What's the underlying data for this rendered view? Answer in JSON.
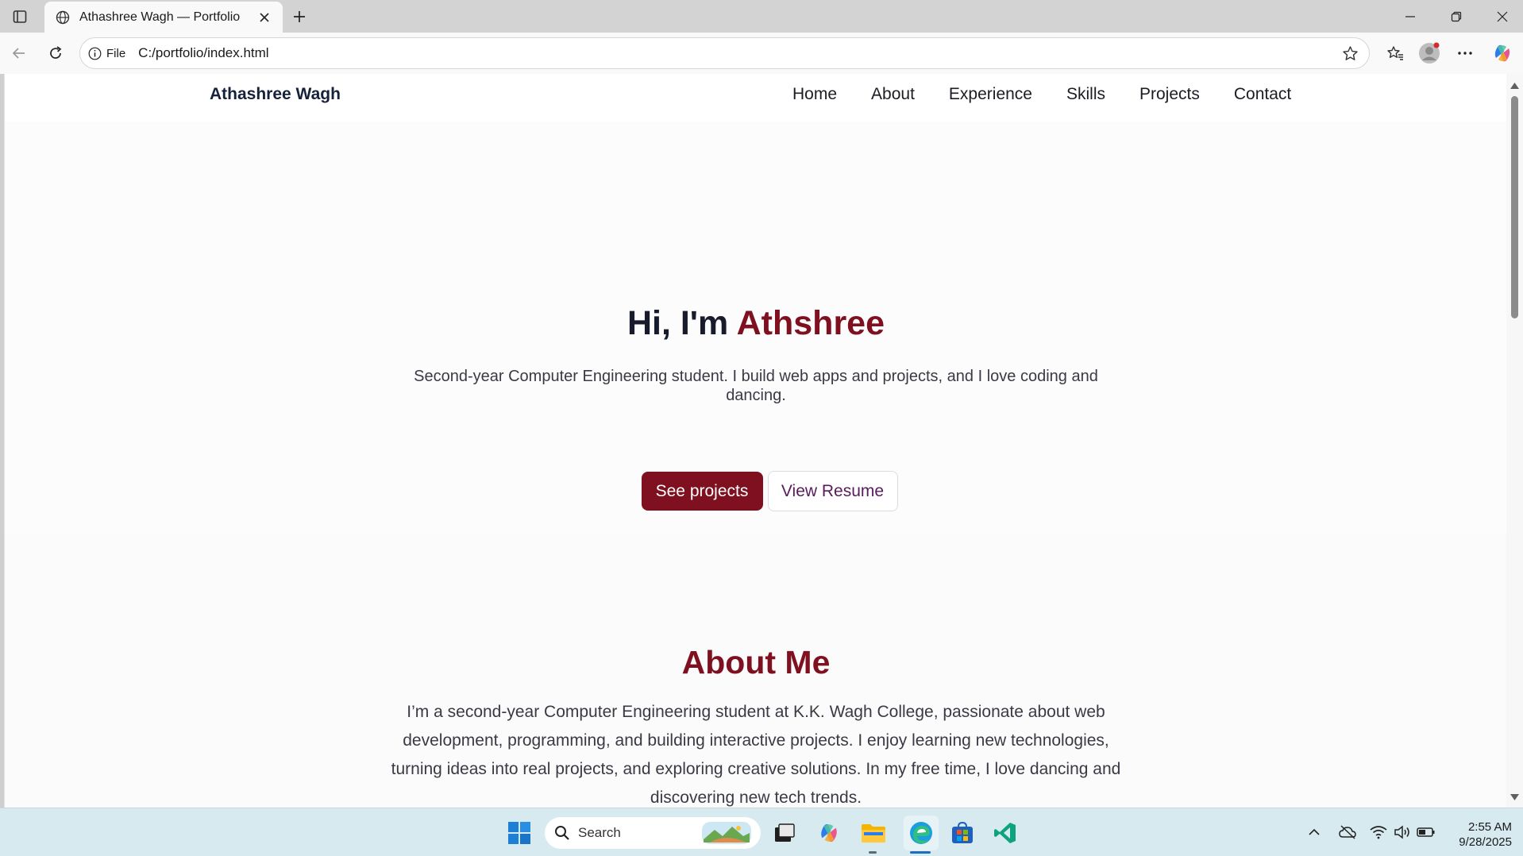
{
  "browser": {
    "tab_title": "Athashree Wagh — Portfolio",
    "address_label": "File",
    "url": "C:/portfolio/index.html"
  },
  "site": {
    "brand": "Athashree Wagh",
    "nav": [
      "Home",
      "About",
      "Experience",
      "Skills",
      "Projects",
      "Contact"
    ],
    "hero": {
      "greeting": "Hi, I'm ",
      "name": "Athshree",
      "subtitle": "Second-year Computer Engineering student. I build web apps and projects, and I love coding and dancing.",
      "primary_button": "See projects",
      "secondary_button": "View Resume"
    },
    "about": {
      "heading": "About Me",
      "body": "I’m a second-year Computer Engineering student at K.K. Wagh College, passionate about web development, programming, and building interactive projects. I enjoy learning new technologies, turning ideas into real projects, and exploring creative solutions. In my free time, I love dancing and discovering new tech trends."
    }
  },
  "taskbar": {
    "search_label": "Search",
    "time": "2:55 AM",
    "date": "9/28/2025"
  },
  "colors": {
    "accent": "#7e1020",
    "heading_dark": "#171b2b",
    "secondary_button_text": "#5a1a5e",
    "taskbar_bg": "#d6eaf0"
  }
}
